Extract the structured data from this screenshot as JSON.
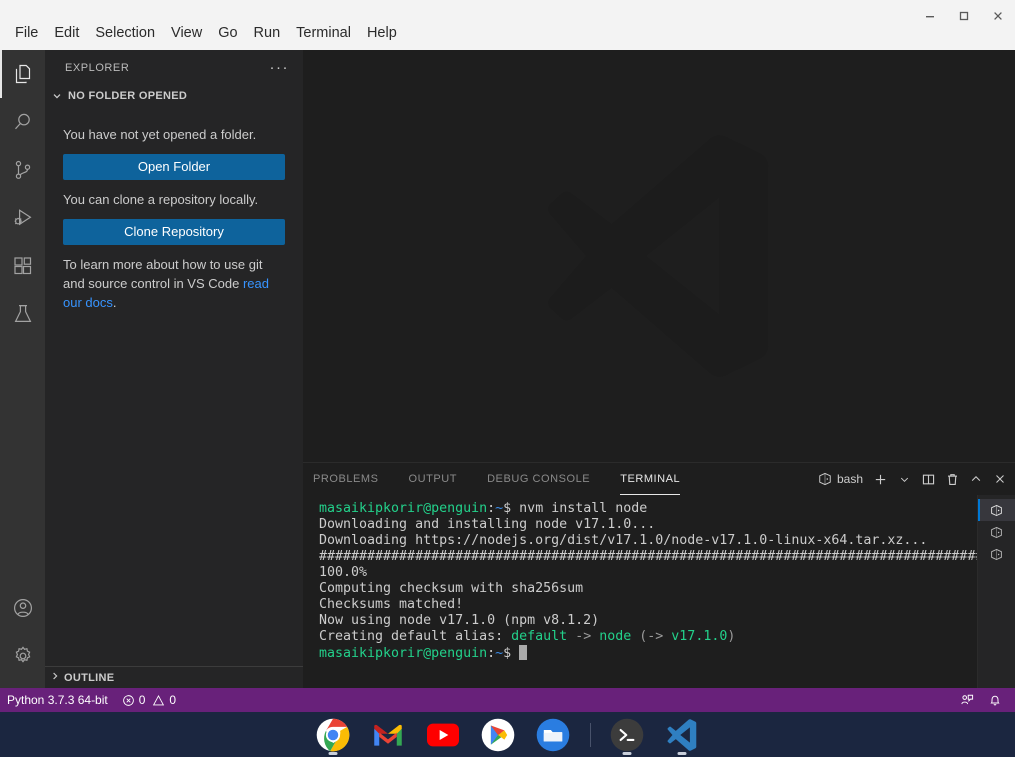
{
  "window": {
    "controls": [
      {
        "name": "minimize",
        "glyph": "minimize-icon"
      },
      {
        "name": "maximize",
        "glyph": "maximize-icon"
      },
      {
        "name": "close",
        "glyph": "close-icon"
      }
    ]
  },
  "menubar": {
    "items": [
      "File",
      "Edit",
      "Selection",
      "View",
      "Go",
      "Run",
      "Terminal",
      "Help"
    ]
  },
  "activitybar": {
    "top": [
      {
        "name": "explorer",
        "icon": "files-icon",
        "active": true
      },
      {
        "name": "search",
        "icon": "search-icon",
        "active": false
      },
      {
        "name": "source-control",
        "icon": "source-control-icon",
        "active": false
      },
      {
        "name": "run-debug",
        "icon": "run-debug-icon",
        "active": false
      },
      {
        "name": "extensions",
        "icon": "extensions-icon",
        "active": false
      },
      {
        "name": "testing",
        "icon": "beaker-icon",
        "active": false
      }
    ],
    "bottom": [
      {
        "name": "accounts",
        "icon": "account-icon"
      },
      {
        "name": "manage",
        "icon": "gear-icon"
      }
    ]
  },
  "sidebar": {
    "title": "EXPLORER",
    "more_actions": "···",
    "section_label": "NO FOLDER OPENED",
    "no_folder_text": "You have not yet opened a folder.",
    "open_folder_label": "Open Folder",
    "clone_text": "You can clone a repository locally.",
    "clone_repo_label": "Clone Repository",
    "docs_text_before": "To learn more about how to use git and source control in VS Code ",
    "docs_link": "read our docs",
    "docs_text_after": ".",
    "outline_label": "OUTLINE"
  },
  "editor": {
    "watermark": "vscode-logo-watermark"
  },
  "panel": {
    "tabs": [
      {
        "label": "PROBLEMS",
        "active": false
      },
      {
        "label": "OUTPUT",
        "active": false
      },
      {
        "label": "DEBUG CONSOLE",
        "active": false
      },
      {
        "label": "TERMINAL",
        "active": true
      }
    ],
    "shell_label": "bash",
    "actions": [
      {
        "name": "new-terminal",
        "icon": "plus-icon"
      },
      {
        "name": "terminal-dropdown",
        "icon": "chevron-down-icon"
      },
      {
        "name": "split-terminal",
        "icon": "split-icon"
      },
      {
        "name": "kill-terminal",
        "icon": "trash-icon"
      },
      {
        "name": "maximize-panel",
        "icon": "chevron-up-icon"
      },
      {
        "name": "close-panel",
        "icon": "close-icon"
      }
    ],
    "terminal_tabs": [
      {
        "name": "bash",
        "active": true
      },
      {
        "name": "bash",
        "active": false
      },
      {
        "name": "bash",
        "active": false
      }
    ]
  },
  "terminal": {
    "prompt_user": "masaikipkorir@penguin",
    "prompt_sep": ":",
    "prompt_path": "~",
    "prompt_sigil": "$",
    "command": " nvm install node",
    "lines": [
      "Downloading and installing node v17.1.0...",
      "Downloading https://nodejs.org/dist/v17.1.0/node-v17.1.0-linux-x64.tar.xz...",
      "########################################################################## 100.0%",
      "Computing checksum with sha256sum",
      "Checksums matched!",
      "Now using node v17.1.0 (npm v8.1.2)"
    ],
    "hashes": "##########################################################################################",
    "percent": "100.0%",
    "alias_prefix": "Creating default alias: ",
    "alias_default": "default",
    "alias_arrow": " -> ",
    "alias_node": "node",
    "alias_paren_open": " (",
    "alias_arrow2": "-> ",
    "alias_version": "v17.1.0",
    "alias_paren_close": ")",
    "colors": {
      "green": "#23d18b",
      "blue": "#3b8eea",
      "text": "#cccccc"
    }
  },
  "statusbar": {
    "python_version": "Python 3.7.3 64-bit",
    "errors": "0",
    "warnings": "0",
    "background": "#68217a",
    "right_items": [
      {
        "name": "feedback",
        "icon": "feedback-icon"
      },
      {
        "name": "notifications",
        "icon": "bell-icon"
      }
    ]
  },
  "shelf": {
    "apps": [
      {
        "name": "chrome",
        "label": "Chrome",
        "running": true
      },
      {
        "name": "gmail",
        "label": "Gmail",
        "running": false
      },
      {
        "name": "youtube",
        "label": "YouTube",
        "running": false
      },
      {
        "name": "play-store",
        "label": "Play Store",
        "running": false
      },
      {
        "name": "files",
        "label": "Files",
        "running": false
      },
      {
        "name": "terminal",
        "label": "Terminal",
        "running": true
      },
      {
        "name": "vscode",
        "label": "Visual Studio Code",
        "running": true
      }
    ]
  }
}
